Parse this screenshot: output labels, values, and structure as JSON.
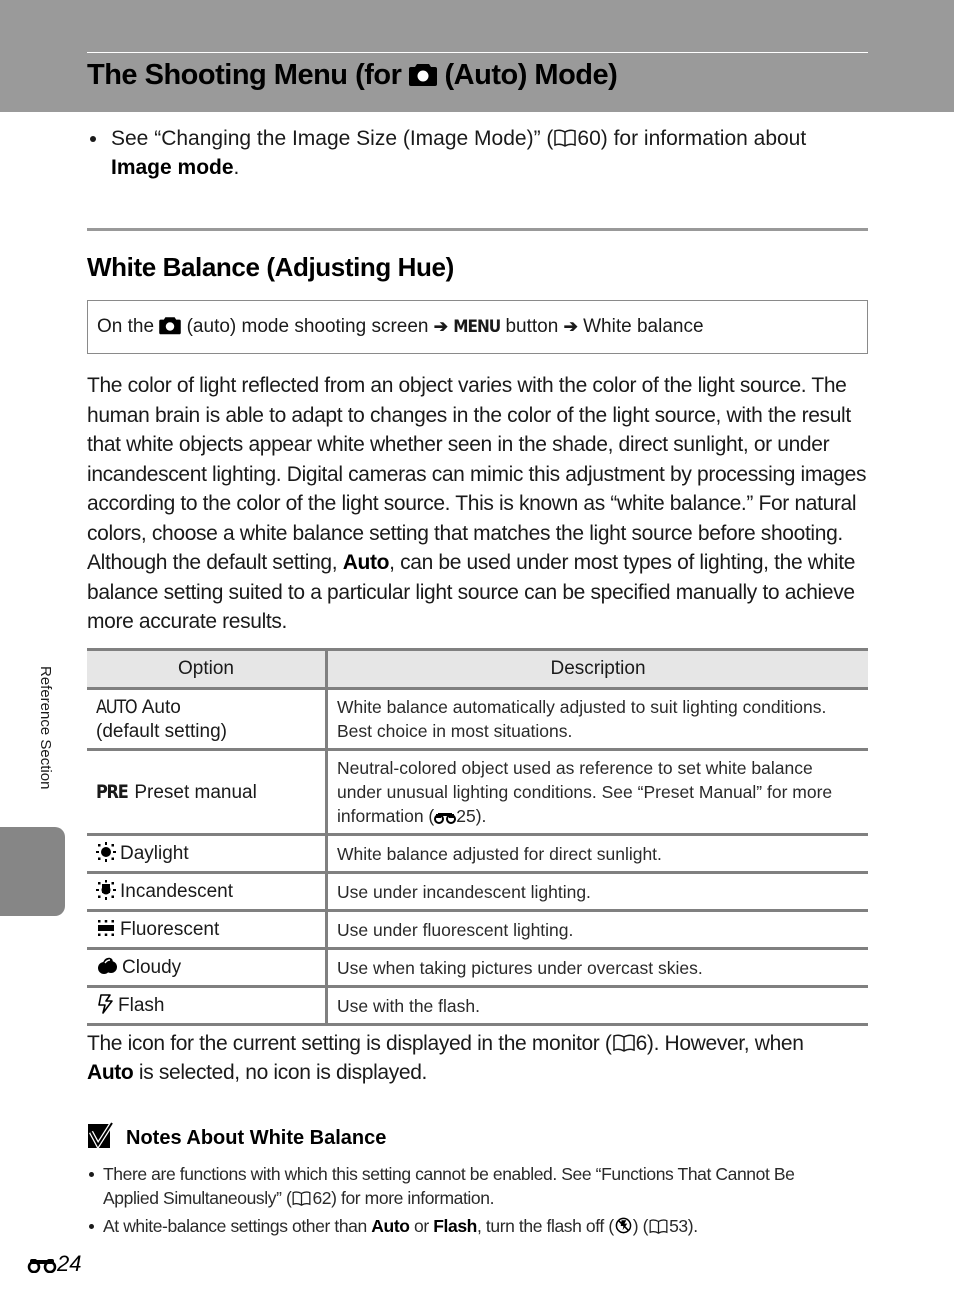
{
  "header": {
    "title_before_icon": "The Shooting Menu (for",
    "title_icon": "camera-auto-icon",
    "title_after_icon": "(Auto) Mode)",
    "band_color": "#9a9a9a"
  },
  "intro": {
    "bullets": [
      {
        "text_before_ref": "See “Changing the Image Size (Image Mode)” (",
        "ref_icon": "book-icon",
        "ref_page": "60",
        "text_after_ref": ") for information about",
        "bold": "Image mode",
        "tail": "."
      }
    ]
  },
  "section": {
    "heading": "White Balance (Adjusting Hue)",
    "nav_path": {
      "prefix": "On the",
      "mode_icon": "camera-auto-icon",
      "mode_text": "(auto) mode shooting screen",
      "arrow": "➔",
      "menu_glyph": "MENU",
      "button_text": "button",
      "destination": "White balance"
    },
    "paragraph": {
      "before_bold": "The color of light reflected from an object varies with the color of the light source. The human brain is able to adapt to changes in the color of the light source, with the result that white objects appear white whether seen in the shade, direct sunlight, or under incandescent lighting. Digital cameras can mimic this adjustment by processing images according to the color of the light source. This is known as “white balance.” For natural colors, choose a white balance setting that matches the light source before shooting. Although the default setting,",
      "bold": "Auto",
      "after_bold": ", can be used under most types of lighting, the white balance setting suited to a particular light source can be specified manually to achieve more accurate results."
    }
  },
  "table": {
    "headers": [
      "Option",
      "Description"
    ],
    "rows": [
      {
        "icon": "auto-wb-icon",
        "icon_text": "AUTO",
        "option": "Auto",
        "option_line2": "(default setting)",
        "description": "White balance automatically adjusted to suit lighting conditions. Best choice in most situations."
      },
      {
        "icon": "preset-wb-icon",
        "icon_text": "PRE",
        "option": "Preset manual",
        "description": "Neutral-colored object used as reference to set white balance under unusual lighting conditions. See “Preset Manual” for more information (",
        "desc_ref_icon": "reference-binoculars-icon",
        "desc_ref_page": "25",
        "desc_tail": ")."
      },
      {
        "icon": "daylight-icon",
        "option": "Daylight",
        "description": "White balance adjusted for direct sunlight."
      },
      {
        "icon": "incandescent-icon",
        "option": "Incandescent",
        "description": "Use under incandescent lighting."
      },
      {
        "icon": "fluorescent-icon",
        "option": "Fluorescent",
        "description": "Use under fluorescent lighting."
      },
      {
        "icon": "cloudy-icon",
        "option": "Cloudy",
        "description": "Use when taking pictures under overcast skies."
      },
      {
        "icon": "flash-wb-icon",
        "option": "Flash",
        "description": "Use with the flash."
      }
    ],
    "header_bg": "#e6e6e6",
    "border_color": "#808080"
  },
  "after_table": {
    "before_ref": "The icon for the current setting is displayed in the monitor (",
    "ref_icon": "book-icon",
    "ref_page": "6",
    "after_ref": "). However, when",
    "bold": "Auto",
    "tail": "is selected, no icon is displayed."
  },
  "notes": {
    "icon": "check-note-icon",
    "heading": "Notes About White Balance",
    "items": [
      {
        "before_ref": "There are functions with which this setting cannot be enabled. See “Functions That Cannot Be Applied Simultaneously” (",
        "ref_icon": "book-icon",
        "ref_page": "62",
        "after_ref": ") for more information."
      },
      {
        "before_bold1": "At white-balance settings other than",
        "bold1": "Auto",
        "middle": "or",
        "bold2": "Flash",
        "after_bold2": ", turn the flash off (",
        "flash_off_icon": "flash-off-icon",
        "after_icon": ") (",
        "ref_icon": "book-icon",
        "ref_page": "53",
        "tail": ")."
      }
    ]
  },
  "sidebar": {
    "label": "Reference Section",
    "tab_color": "#868686"
  },
  "footer": {
    "page_icon": "reference-binoculars-icon",
    "page_number": "24"
  }
}
